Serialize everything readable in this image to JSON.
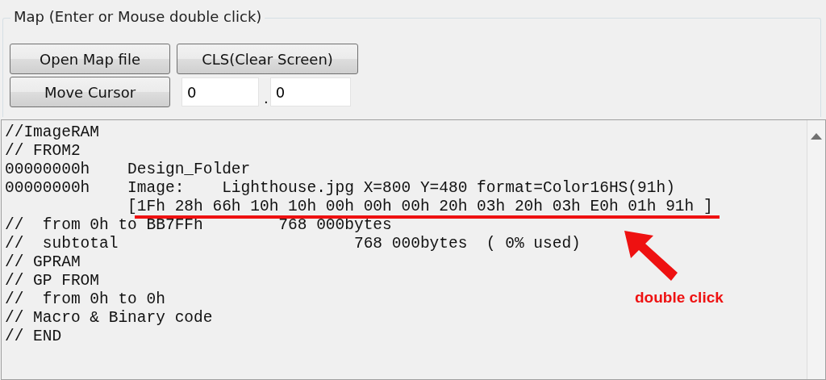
{
  "group": {
    "title": "Map (Enter or Mouse double click)"
  },
  "buttons": [
    {
      "label": "Open Map file"
    },
    {
      "label": "CLS(Clear Screen)"
    },
    {
      "label": "Move Cursor"
    }
  ],
  "cursor_fields": [
    {
      "value": "0"
    },
    {
      "value": "0"
    }
  ],
  "separator": ".",
  "text_area": {
    "lines": [
      "//ImageRAM",
      "// FROM2",
      "00000000h    Design_Folder",
      "00000000h    Image:    Lighthouse.jpg X=800 Y=480 format=Color16HS(91h)",
      "             [1Fh 28h 66h 10h 10h 00h 00h 00h 20h 03h 20h 03h E0h 01h 91h ]",
      "//  from 0h to BB7FFh        768 000bytes",
      "//  subtotal                         768 000bytes  ( 0% used)",
      "// GPRAM",
      "// GP FROM",
      "//  from 0h to 0h",
      "// Macro & Binary code",
      "// END"
    ]
  },
  "annotation": {
    "label": "double click"
  }
}
